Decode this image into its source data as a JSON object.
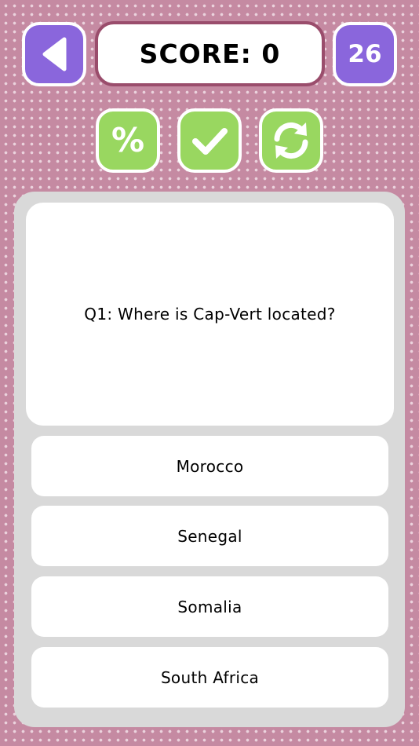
{
  "header": {
    "score_text": "SCORE: 0",
    "level_number": "26",
    "back_icon": "back-arrow-icon"
  },
  "tools": {
    "hint_symbol": "%",
    "hint_icon": "percent-icon",
    "check_icon": "checkmark-icon",
    "refresh_icon": "refresh-icon"
  },
  "quiz": {
    "question": "Q1: Where is Cap-Vert located?",
    "answers": [
      "Morocco",
      "Senegal",
      "Somalia",
      "South Africa"
    ]
  },
  "colors": {
    "background": "#c58aa2",
    "purple_button": "#8a66dc",
    "green_button": "#99d760",
    "score_border": "#9a4d6c",
    "panel": "#d9d9d9"
  }
}
